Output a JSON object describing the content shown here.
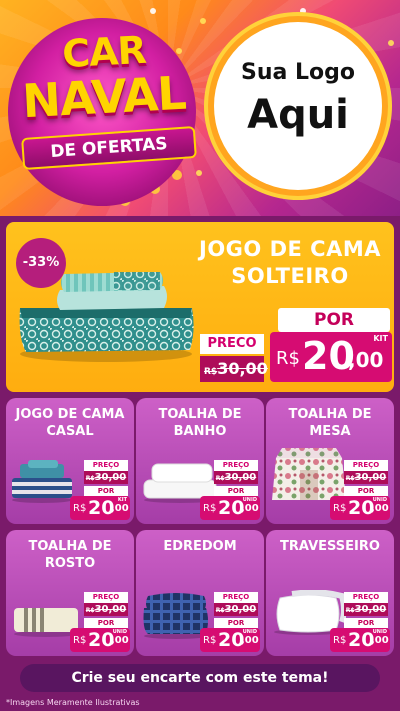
{
  "hero": {
    "title_line1": "CAR",
    "title_line2": "NAVAL",
    "subtitle": "DE OFERTAS",
    "logo_line1": "Sua Logo",
    "logo_line2": "Aqui"
  },
  "featured": {
    "discount": "-33%",
    "title_line1": "JOGO DE CAMA",
    "title_line2": "SOLTEIRO",
    "preco_label": "PRECO",
    "old_currency": "R$",
    "old_value": "30,00",
    "por_label": "POR",
    "currency": "R$",
    "price_int": "20",
    "price_dec": ",00",
    "unit": "KIT"
  },
  "products": [
    {
      "name_line1": "JOGO DE CAMA",
      "name_line2": "CASAL",
      "preco_label": "PREÇO",
      "old_currency": "R$",
      "old_value": "30,00",
      "por_label": "POR",
      "currency": "R$",
      "price_int": "20",
      "price_dec": ",00",
      "unit": "KIT",
      "image_icon": "bedding-set-icon"
    },
    {
      "name_line1": "TOALHA DE",
      "name_line2": "BANHO",
      "preco_label": "PREÇO",
      "old_currency": "R$",
      "old_value": "30,00",
      "por_label": "POR",
      "currency": "R$",
      "price_int": "20",
      "price_dec": ",00",
      "unit": "UNID",
      "image_icon": "bath-towel-icon"
    },
    {
      "name_line1": "TOALHA DE MESA",
      "name_line2": "",
      "preco_label": "PREÇO",
      "old_currency": "R$",
      "old_value": "30,00",
      "por_label": "POR",
      "currency": "R$",
      "price_int": "20",
      "price_dec": ",00",
      "unit": "UNID",
      "image_icon": "tablecloth-icon"
    },
    {
      "name_line1": "TOALHA DE",
      "name_line2": "ROSTO",
      "preco_label": "PREÇO",
      "old_currency": "R$",
      "old_value": "30,00",
      "por_label": "POR",
      "currency": "R$",
      "price_int": "20",
      "price_dec": ",00",
      "unit": "UNID",
      "image_icon": "face-towel-icon"
    },
    {
      "name_line1": "EDREDOM",
      "name_line2": "",
      "preco_label": "PREÇO",
      "old_currency": "R$",
      "old_value": "30,00",
      "por_label": "POR",
      "currency": "R$",
      "price_int": "20",
      "price_dec": ",00",
      "unit": "UNID",
      "image_icon": "comforter-icon"
    },
    {
      "name_line1": "TRAVESSEIRO",
      "name_line2": "",
      "preco_label": "PREÇO",
      "old_currency": "R$",
      "old_value": "30,00",
      "por_label": "POR",
      "currency": "R$",
      "price_int": "20",
      "price_dec": ",00",
      "unit": "UNID",
      "image_icon": "pillow-icon"
    }
  ],
  "footer": {
    "cta": "Crie seu encarte com este tema!",
    "disclaimer": "*Imagens Meramente Ilustrativas"
  },
  "colors": {
    "magenta": "#d60c72",
    "yellow": "#ffc21d",
    "purple": "#7a1a6a"
  }
}
